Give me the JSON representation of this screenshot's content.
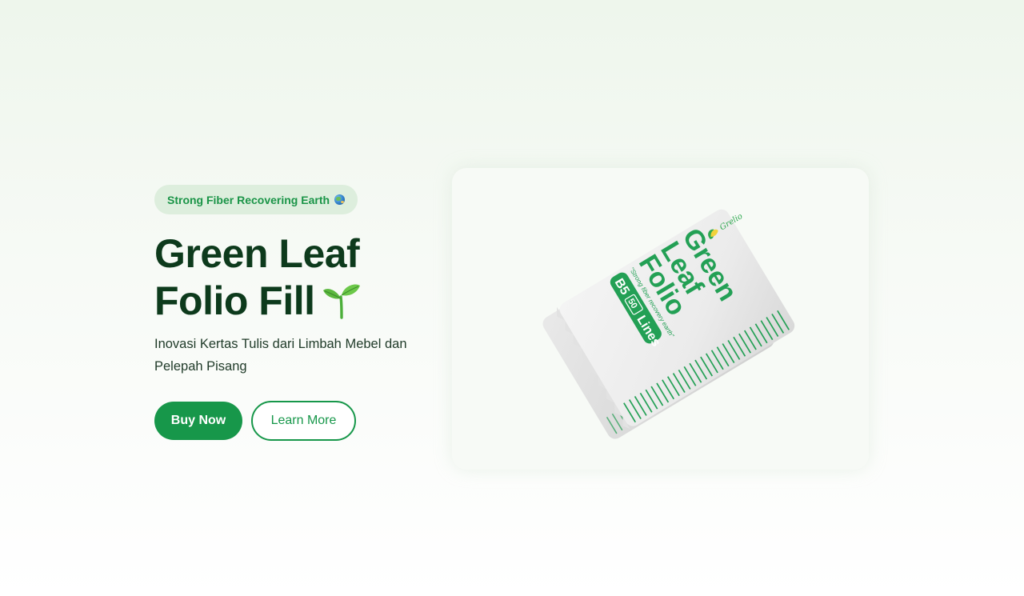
{
  "hero": {
    "badge": {
      "text": "Strong Fiber Recovering Earth",
      "icon": "globe-icon"
    },
    "title": {
      "line1": "Green Leaf",
      "line2": "Folio Fill",
      "icon": "sprout-icon"
    },
    "subtitle": "Inovasi Kertas Tulis dari Limbah Mebel dan Pelepah Pisang",
    "buttons": {
      "primary_label": "Buy Now",
      "secondary_label": "Learn More"
    },
    "product": {
      "brand": "Grelio",
      "name_line1": "Green",
      "name_line2": "Leaf",
      "name_line3": "Folio",
      "tagline": "\"Strong fiber recovery earth\"",
      "size": "B5",
      "count": "50",
      "lines": "Lines"
    }
  },
  "colors": {
    "brand_green": "#17974a",
    "title_dark_green": "#0d3a1c",
    "badge_bg": "#ddeedd"
  }
}
